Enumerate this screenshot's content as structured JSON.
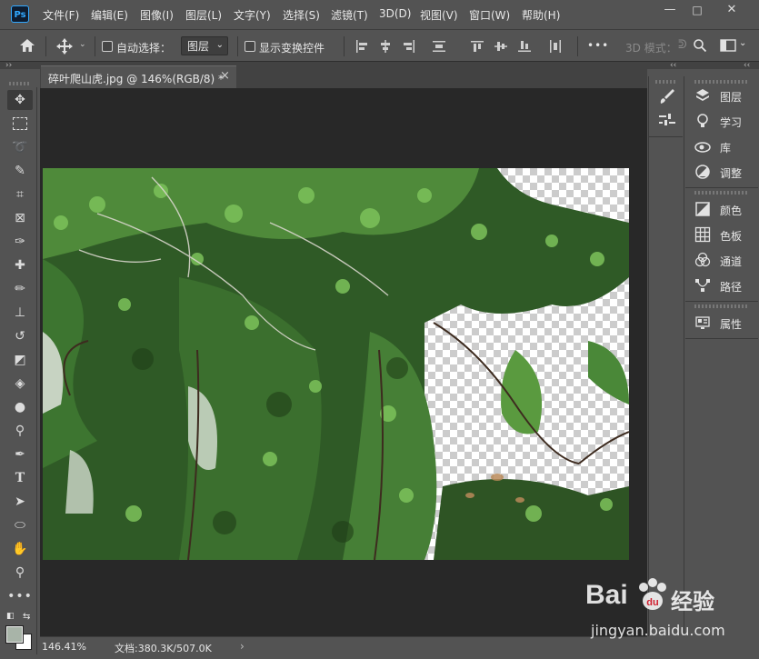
{
  "app": {
    "logo_text": "Ps",
    "menu": [
      "文件(F)",
      "编辑(E)",
      "图像(I)",
      "图层(L)",
      "文字(Y)",
      "选择(S)",
      "滤镜(T)",
      "3D(D)",
      "视图(V)",
      "窗口(W)",
      "帮助(H)"
    ],
    "window_controls": {
      "minimize": "—",
      "restore": "□",
      "close": "✕"
    }
  },
  "options": {
    "auto_select_label": "自动选择：",
    "auto_select_value": "图层",
    "show_transform_label": "显示变换控件",
    "more": "•••",
    "mode_3d": "3D 模式："
  },
  "document": {
    "tab_title": "碎叶爬山虎.jpg @ 146%(RGB/8) *",
    "tab_close": "×"
  },
  "status": {
    "zoom": "146.41%",
    "doc_info": "文档:380.3K/507.0K",
    "arrow": "›"
  },
  "panels": {
    "items": [
      {
        "label": "图层",
        "icon": "layers-icon"
      },
      {
        "label": "学习",
        "icon": "lightbulb-icon"
      },
      {
        "label": "库",
        "icon": "libraries-icon"
      },
      {
        "label": "调整",
        "icon": "adjustments-icon"
      },
      {
        "label": "颜色",
        "icon": "color-icon"
      },
      {
        "label": "色板",
        "icon": "swatches-icon"
      },
      {
        "label": "通道",
        "icon": "channels-icon"
      },
      {
        "label": "路径",
        "icon": "paths-icon"
      },
      {
        "label": "属性",
        "icon": "properties-icon"
      }
    ],
    "collapse_glyph": "‹‹"
  },
  "watermark": {
    "brand": "Bai",
    "brand_cn": "经验",
    "url": "jingyan.baidu.com"
  },
  "colors": {
    "ui_bg": "#535353",
    "pasteboard": "#282828",
    "accent": "#31a8ff"
  }
}
